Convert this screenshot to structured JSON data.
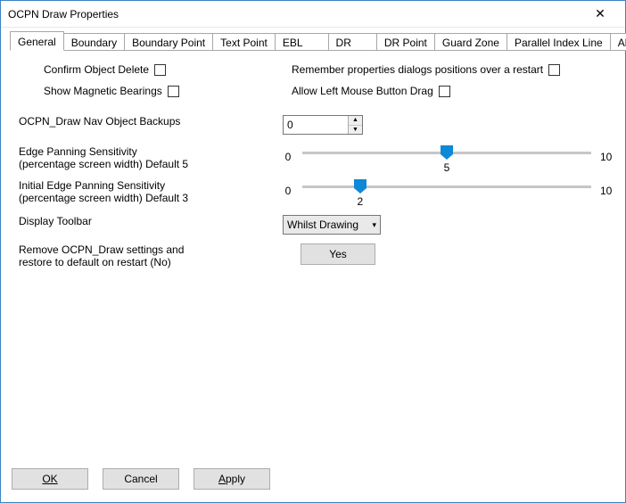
{
  "window": {
    "title": "OCPN Draw Properties"
  },
  "tabs": {
    "items": [
      "General",
      "Boundary",
      "Boundary Point",
      "Text Point",
      "EBL",
      "DR",
      "DR Point",
      "Guard Zone",
      "Parallel Index Line",
      "About"
    ],
    "active_index": 0
  },
  "general": {
    "confirm_delete_label": "Confirm Object Delete",
    "show_mag_label": "Show Magnetic Bearings",
    "remember_label": "Remember properties dialogs positions over a restart",
    "allow_drag_label": "Allow Left Mouse Button Drag",
    "nav_backup_label": "OCPN_Draw Nav Object Backups",
    "nav_backup_value": "0",
    "edge_pan": {
      "label_line1": "Edge Panning Sensitivity",
      "label_line2": "(percentage screen width) Default 5",
      "min": "0",
      "max": "10",
      "value": "5",
      "percent": 50
    },
    "init_edge_pan": {
      "label_line1": "Initial Edge Panning Sensitivity",
      "label_line2": "(percentage screen width) Default 3",
      "min": "0",
      "max": "10",
      "value": "2",
      "percent": 20
    },
    "display_toolbar_label": "Display Toolbar",
    "display_toolbar_value": "Whilst Drawing",
    "remove_label_line1": "Remove OCPN_Draw settings and",
    "remove_label_line2": "restore to default on restart (No)",
    "yes_button": "Yes"
  },
  "buttons": {
    "ok": "OK",
    "cancel": "Cancel",
    "apply": "Apply"
  }
}
